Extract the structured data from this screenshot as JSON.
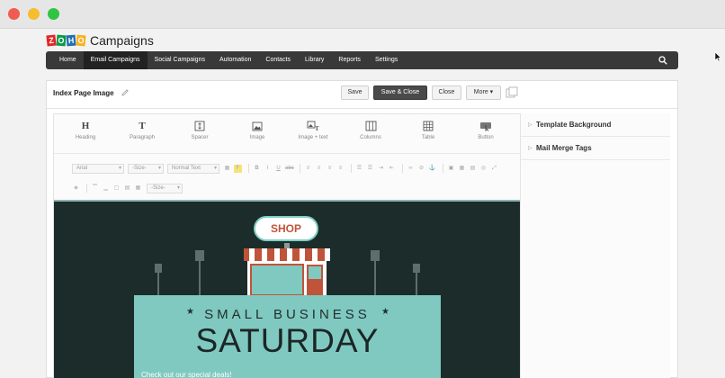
{
  "logo": {
    "letters": [
      "Z",
      "O",
      "H",
      "O"
    ],
    "word": "Campaigns"
  },
  "nav": {
    "items": [
      "Home",
      "Email Campaigns",
      "Social Campaigns",
      "Automation",
      "Contacts",
      "Library",
      "Reports",
      "Settings"
    ],
    "active": "Email Campaigns",
    "search_icon": "search-icon"
  },
  "header": {
    "title": "Index Page Image",
    "buttons": {
      "save": "Save",
      "save_close": "Save & Close",
      "close": "Close",
      "more": "More ▾"
    }
  },
  "blocks": [
    {
      "label": "Heading",
      "icon": "H"
    },
    {
      "label": "Paragraph",
      "icon": "T"
    },
    {
      "label": "Spacer",
      "icon": "spacer-icon"
    },
    {
      "label": "Image",
      "icon": "image-icon"
    },
    {
      "label": "Image + text",
      "icon": "image-text-icon"
    },
    {
      "label": "Columns",
      "icon": "columns-icon"
    },
    {
      "label": "Table",
      "icon": "table-icon"
    },
    {
      "label": "Button",
      "icon": "button-icon"
    }
  ],
  "toolbar": {
    "font": "Arial",
    "size": "-Size-",
    "style": "Normal Text",
    "size2": "-Size-",
    "format_letters": [
      "B",
      "I",
      "U",
      "abc"
    ]
  },
  "canvas": {
    "sign": "SHOP",
    "subtitle": "SMALL BUSINESS",
    "title": "SATURDAY",
    "deal": "Check out our special deals!"
  },
  "sidebar": {
    "items": [
      "Template Background",
      "Mail Merge Tags"
    ]
  },
  "colors": {
    "nav_bg": "#393939",
    "canvas_bg": "#1c2c2b",
    "card_bg": "#7fc9c0",
    "sign_text": "#c0543a"
  }
}
